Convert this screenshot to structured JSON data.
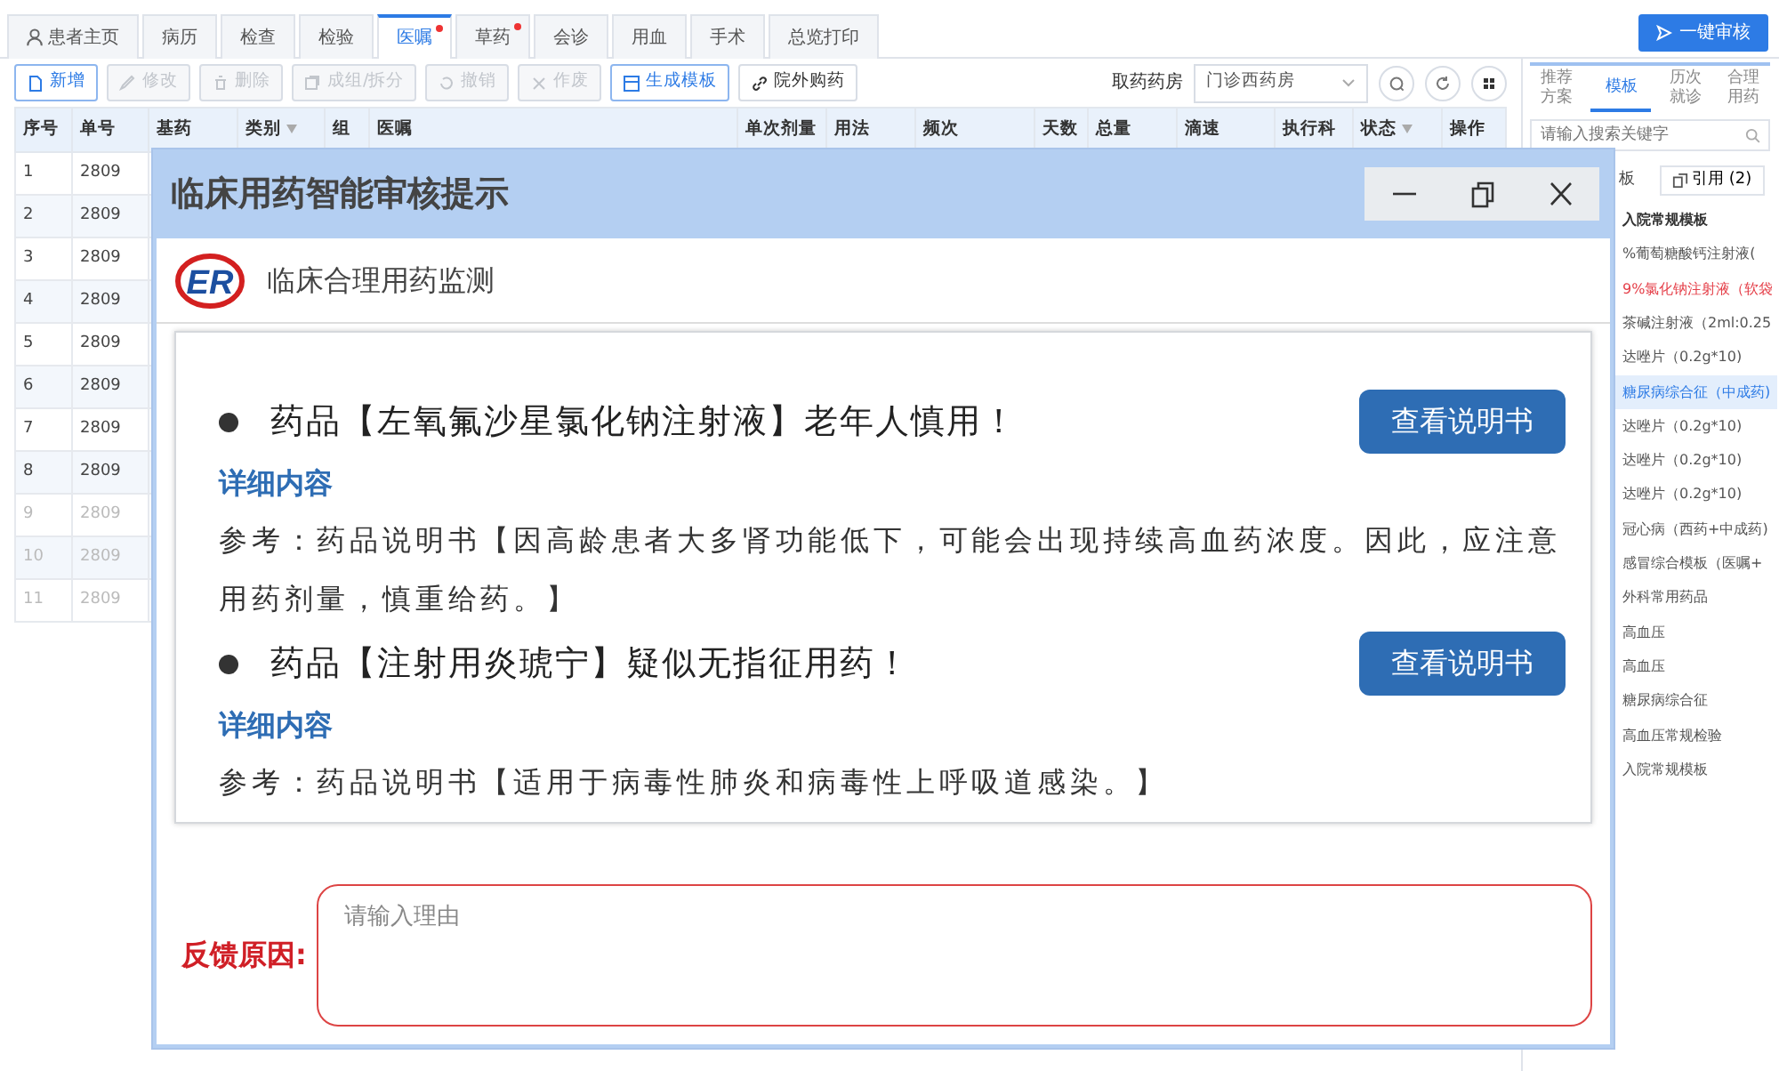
{
  "tabs": [
    {
      "label": "患者主页",
      "icon": true,
      "selected": false,
      "badge": false
    },
    {
      "label": "病历",
      "icon": false,
      "selected": false,
      "badge": false
    },
    {
      "label": "检查",
      "icon": false,
      "selected": false,
      "badge": false
    },
    {
      "label": "检验",
      "icon": false,
      "selected": false,
      "badge": false
    },
    {
      "label": "医嘱",
      "icon": false,
      "selected": true,
      "badge": true
    },
    {
      "label": "草药",
      "icon": false,
      "selected": false,
      "badge": true
    },
    {
      "label": "会诊",
      "icon": false,
      "selected": false,
      "badge": false
    },
    {
      "label": "用血",
      "icon": false,
      "selected": false,
      "badge": false
    },
    {
      "label": "手术",
      "icon": false,
      "selected": false,
      "badge": false
    },
    {
      "label": "总览打印",
      "icon": false,
      "selected": false,
      "badge": false
    }
  ],
  "review_button": "一键审核",
  "toolbar": [
    {
      "label": "新增",
      "kind": "add",
      "disabled": false
    },
    {
      "label": "修改",
      "kind": "edit",
      "disabled": true
    },
    {
      "label": "删除",
      "kind": "delete",
      "disabled": true
    },
    {
      "label": "成组/拆分",
      "kind": "group",
      "disabled": true
    },
    {
      "label": "撤销",
      "kind": "undo",
      "disabled": true
    },
    {
      "label": "作废",
      "kind": "void",
      "disabled": true
    },
    {
      "label": "生成模板",
      "kind": "template",
      "disabled": false
    },
    {
      "label": "院外购药",
      "kind": "link",
      "disabled": false
    }
  ],
  "pharmacy": {
    "label": "取药药房",
    "value": "门诊西药房"
  },
  "table": {
    "columns": [
      {
        "label": "序号",
        "filter": false
      },
      {
        "label": "单号",
        "filter": false
      },
      {
        "label": "基药",
        "filter": false
      },
      {
        "label": "类别",
        "filter": true
      },
      {
        "label": "组",
        "filter": false
      },
      {
        "label": "医嘱",
        "filter": false
      },
      {
        "label": "单次剂量",
        "filter": false
      },
      {
        "label": "用法",
        "filter": false
      },
      {
        "label": "频次",
        "filter": false
      },
      {
        "label": "天数",
        "filter": false
      },
      {
        "label": "总量",
        "filter": false
      },
      {
        "label": "滴速",
        "filter": false
      },
      {
        "label": "执行科",
        "filter": false
      },
      {
        "label": "状态",
        "filter": true
      },
      {
        "label": "操作",
        "filter": false
      }
    ],
    "rows": [
      {
        "seq": "1",
        "order_no": "2809",
        "disabled": false
      },
      {
        "seq": "2",
        "order_no": "2809",
        "disabled": false
      },
      {
        "seq": "3",
        "order_no": "2809",
        "disabled": false
      },
      {
        "seq": "4",
        "order_no": "2809",
        "disabled": false
      },
      {
        "seq": "5",
        "order_no": "2809",
        "disabled": false
      },
      {
        "seq": "6",
        "order_no": "2809",
        "disabled": false
      },
      {
        "seq": "7",
        "order_no": "2809",
        "disabled": false
      },
      {
        "seq": "8",
        "order_no": "2809",
        "disabled": false
      },
      {
        "seq": "9",
        "order_no": "2809",
        "disabled": true
      },
      {
        "seq": "10",
        "order_no": "2809",
        "disabled": true
      },
      {
        "seq": "11",
        "order_no": "2809",
        "disabled": true
      }
    ]
  },
  "side_panel": {
    "tabs": [
      {
        "label": "推荐方案",
        "selected": false
      },
      {
        "label": "模板",
        "selected": true
      },
      {
        "label": "历次就诊",
        "selected": false
      },
      {
        "label": "合理用药",
        "selected": false
      }
    ],
    "search_placeholder": "请输入搜索关键字",
    "subtab": "板",
    "quote_button": "引用 (2)",
    "items": [
      {
        "label": "入院常规模板",
        "kind": "group",
        "selected": false
      },
      {
        "label": "%葡萄糖酸钙注射液(",
        "kind": "item",
        "selected": false
      },
      {
        "label": "9%氯化钠注射液（软袋",
        "kind": "warning",
        "selected": false
      },
      {
        "label": "茶碱注射液（2ml:0.25",
        "kind": "item",
        "selected": false
      },
      {
        "label": "达唑片（0.2g*10)",
        "kind": "item",
        "selected": false
      },
      {
        "label": "糖尿病综合征（中成药)",
        "kind": "item",
        "selected": true
      },
      {
        "label": "达唑片（0.2g*10)",
        "kind": "item",
        "selected": false
      },
      {
        "label": "达唑片（0.2g*10)",
        "kind": "item",
        "selected": false
      },
      {
        "label": "达唑片（0.2g*10)",
        "kind": "item",
        "selected": false
      },
      {
        "label": "冠心病（西药+中成药)",
        "kind": "item",
        "selected": false
      },
      {
        "label": "感冒综合模板（医嘱+",
        "kind": "item",
        "selected": false
      },
      {
        "label": "外科常用药品",
        "kind": "item",
        "selected": false
      },
      {
        "label": "高血压",
        "kind": "item",
        "selected": false
      },
      {
        "label": "高血压",
        "kind": "item",
        "selected": false
      },
      {
        "label": "糖尿病综合征",
        "kind": "item",
        "selected": false
      },
      {
        "label": "高血压常规检验",
        "kind": "item",
        "selected": false
      },
      {
        "label": "入院常规模板",
        "kind": "item",
        "selected": false
      }
    ]
  },
  "dialog": {
    "title": "临床用药智能审核提示",
    "logo_text": "ER",
    "subtitle": "临床合理用药监测",
    "alerts": [
      {
        "message": "药品【左氧氟沙星氯化钠注射液】老年人慎用！",
        "button": "查看说明书",
        "detail_label": "详细内容",
        "reference": "参考：药品说明书【因高龄患者大多肾功能低下，可能会出现持续高血药浓度。因此，应注意用药剂量，慎重给药。】"
      },
      {
        "message": "药品【注射用炎琥宁】疑似无指征用药！",
        "button": "查看说明书",
        "detail_label": "详细内容",
        "reference": "参考：药品说明书【适用于病毒性肺炎和病毒性上呼吸道感染。】"
      }
    ],
    "feedback": {
      "label": "反馈原因:",
      "placeholder": "请输入理由"
    }
  }
}
